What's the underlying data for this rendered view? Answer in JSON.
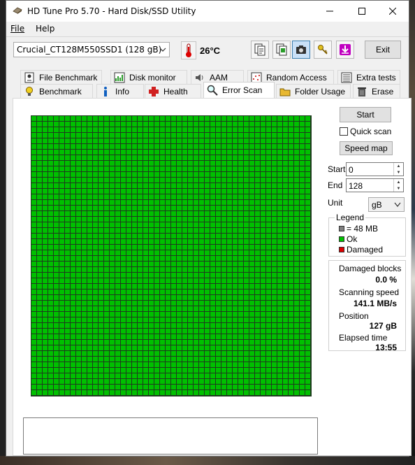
{
  "window": {
    "title": "HD Tune Pro 5.70 - Hard Disk/SSD Utility"
  },
  "menu": [
    "File",
    "Help"
  ],
  "toolbar": {
    "drive": "Crucial_CT128M550SSD1 (128 gB)",
    "temperature": "26°C",
    "buttons": [
      "copy-text-icon",
      "copy-image-icon",
      "screenshot-camera-icon",
      "options-keys-icon",
      "save-download-icon"
    ],
    "exit_label": "Exit"
  },
  "tabs": {
    "top": [
      "File Benchmark",
      "Disk monitor",
      "AAM",
      "Random Access",
      "Extra tests"
    ],
    "bottom": [
      "Benchmark",
      "Info",
      "Health",
      "Error Scan",
      "Folder Usage",
      "Erase"
    ],
    "selected": "Error Scan"
  },
  "error_scan": {
    "start_button": "Start",
    "quick_scan_label": "Quick scan",
    "quick_scan_checked": false,
    "speed_map_button": "Speed map",
    "start_label": "Start",
    "start_value": "0",
    "end_label": "End",
    "end_value": "128",
    "unit_label": "Unit",
    "unit_value": "gB",
    "legend": {
      "title": "Legend",
      "block": "= 48 MB",
      "ok": "Ok",
      "damaged": "Damaged"
    },
    "colors": {
      "ok": "#00c000",
      "damaged": "#e00000",
      "block": "#808080"
    },
    "stats": {
      "damaged_blocks_label": "Damaged blocks",
      "damaged_blocks_value": "0.0 %",
      "scanning_speed_label": "Scanning speed",
      "scanning_speed_value": "141.1 MB/s",
      "position_label": "Position",
      "position_value": "127 gB",
      "elapsed_label": "Elapsed time",
      "elapsed_value": "13:55"
    }
  }
}
